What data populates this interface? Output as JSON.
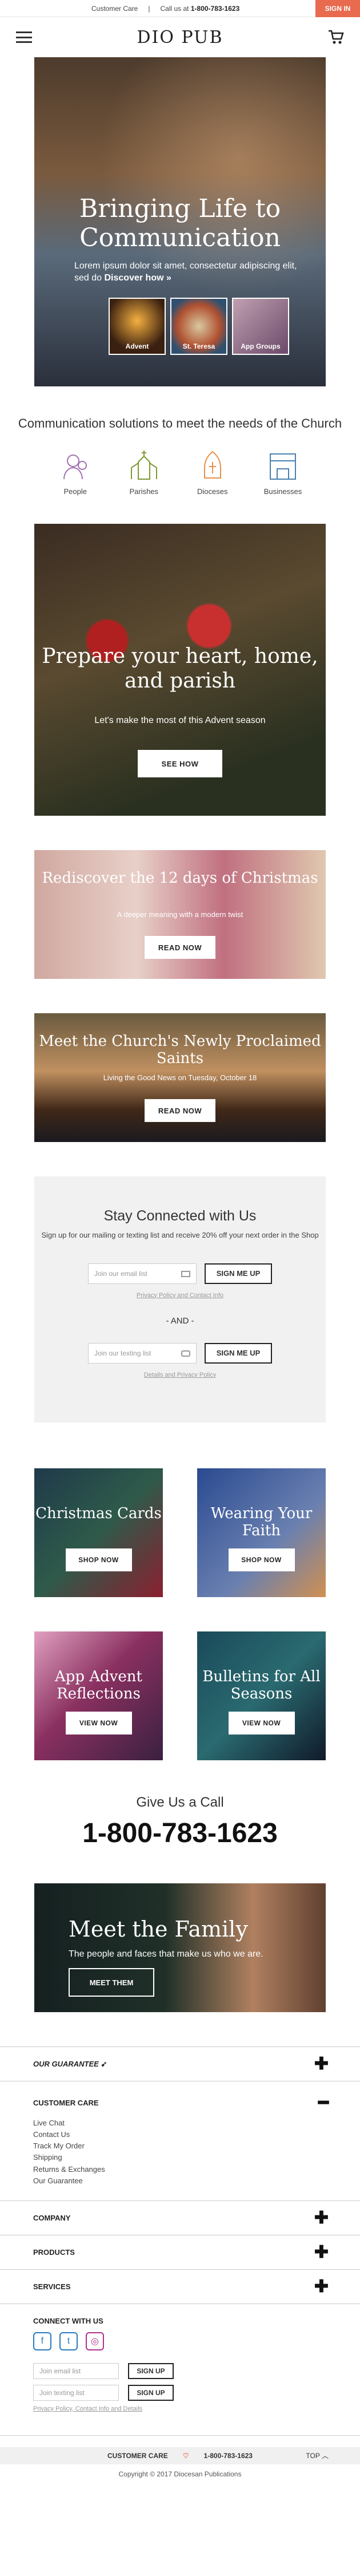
{
  "topbar": {
    "customer_care": "Customer Care",
    "call_us": "Call us at",
    "phone": "1-800-783-1623",
    "signin": "SIGN IN"
  },
  "header": {
    "logo": "DIO PUB"
  },
  "hero": {
    "title": "Bringing Life to Communication",
    "subtitle": "Lorem ipsum dolor sit amet, consectetur adipiscing elit, sed do",
    "discover": "Discover how »",
    "thumbs": [
      "Advent",
      "St. Teresa",
      "App Groups"
    ]
  },
  "communication": {
    "title": "Communication solutions to meet the needs of the Church",
    "audiences": [
      "People",
      "Parishes",
      "Dioceses",
      "Businesses"
    ]
  },
  "advent": {
    "title": "Prepare your heart, home, and parish",
    "subtitle": "Let's make the most of this Advent season",
    "button": "SEE HOW"
  },
  "christmas": {
    "title": "Rediscover the 12 days of Christmas",
    "subtitle": "A deeper meaning with a modern twist",
    "button": "READ NOW"
  },
  "saints": {
    "title": "Meet the Church's Newly Proclaimed Saints",
    "subtitle": "Living the Good News on Tuesday, October 18",
    "button": "READ NOW"
  },
  "stay": {
    "title": "Stay Connected with Us",
    "desc": "Sign up for our mailing or texting list and receive 20% off your next order in the Shop",
    "email_placeholder": "Join our email list",
    "signup": "SIGN ME UP",
    "link1": "Privacy Policy and Contact Info",
    "and": "- AND -",
    "text_placeholder": "Join our texting list",
    "link2": "Details and Privacy Policy"
  },
  "tiles": [
    {
      "title": "Christmas Cards",
      "button": "SHOP NOW"
    },
    {
      "title": "Wearing Your Faith",
      "button": "SHOP NOW"
    },
    {
      "title": "App Advent Reflections",
      "button": "VIEW NOW"
    },
    {
      "title": "Bulletins for All Seasons",
      "button": "VIEW NOW"
    }
  ],
  "call": {
    "title": "Give Us a Call",
    "number": "1-800-783-1623"
  },
  "family": {
    "title": "Meet the Family",
    "subtitle": "The people and faces that make us who we are.",
    "button": "MEET THEM"
  },
  "footer": {
    "guarantee": "OUR GUARANTEE",
    "customer_care": {
      "title": "CUSTOMER CARE",
      "items": [
        "Live Chat",
        "Contact Us",
        "Track My Order",
        "Shipping",
        "Returns & Exchanges",
        "Our Guarantee"
      ]
    },
    "company": "COMPANY",
    "products": "PRODUCTS",
    "services": "SERVICES",
    "connect": {
      "title": "CONNECT WITH US",
      "email_placeholder": "Join email list",
      "text_placeholder": "Join texting list",
      "signup": "SIGN UP",
      "links": "Privacy Policy, Contact Info and Details"
    },
    "bottom": {
      "customer_care": "CUSTOMER CARE",
      "phone": "1-800-783-1623",
      "top": "TOP"
    },
    "copyright": "Copyright © 2017 Diocesan Publications"
  },
  "colors": {
    "accent": "#e86a4f"
  }
}
